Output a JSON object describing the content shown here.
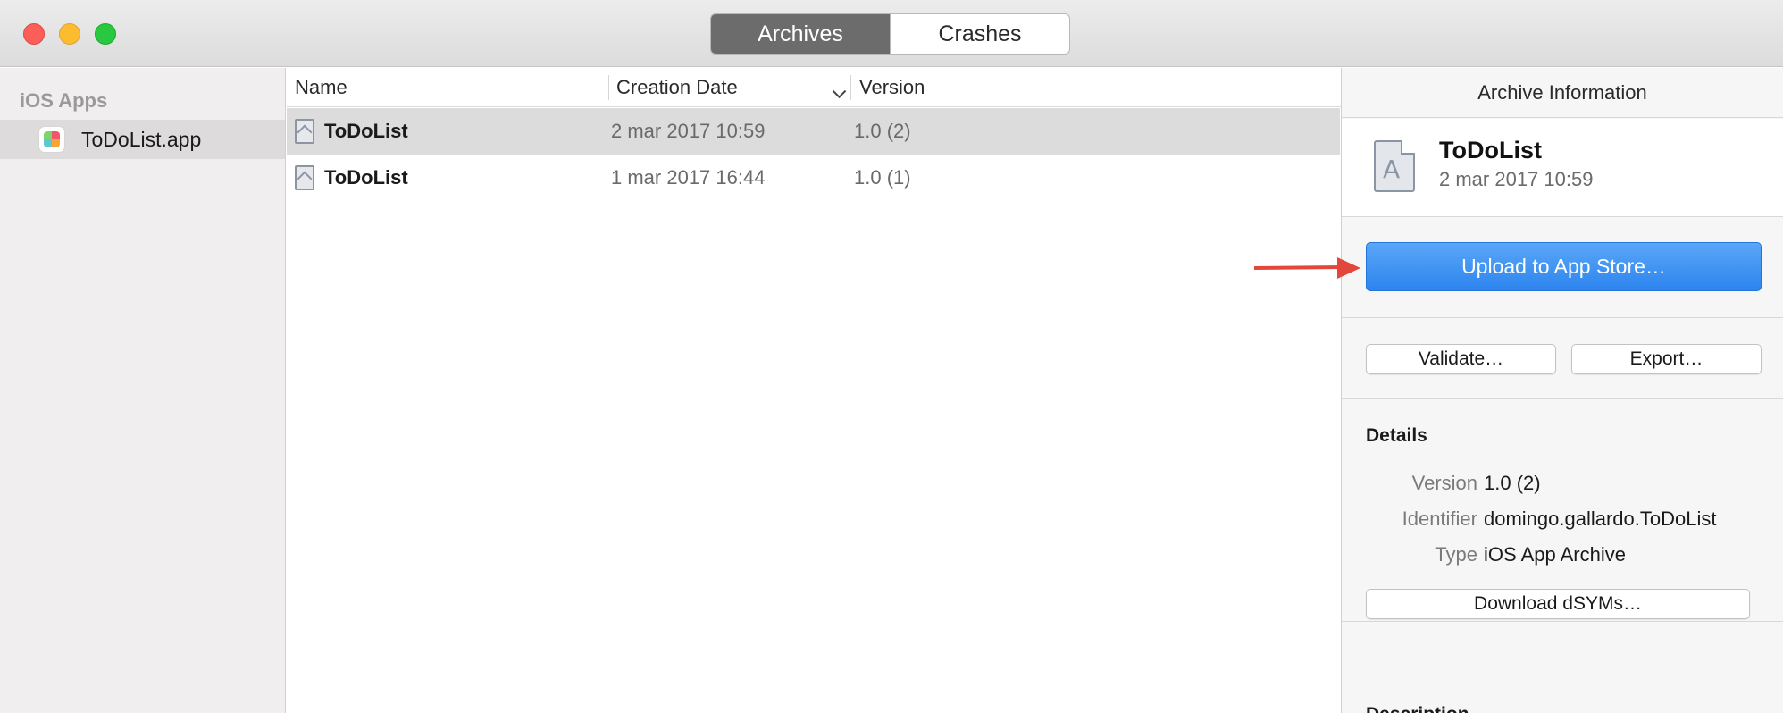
{
  "window": {
    "segments": [
      {
        "label": "Archives",
        "active": true
      },
      {
        "label": "Crashes",
        "active": false
      }
    ]
  },
  "sidebar": {
    "heading": "iOS Apps",
    "items": [
      {
        "label": "ToDoList.app",
        "icon": "app-icon",
        "selected": true
      }
    ]
  },
  "list": {
    "columns": [
      {
        "label": "Name"
      },
      {
        "label": "Creation Date",
        "sorted": "descending"
      },
      {
        "label": "Version"
      }
    ],
    "rows": [
      {
        "name": "ToDoList",
        "date": "2 mar 2017 10:59",
        "version": "1.0 (2)",
        "selected": true
      },
      {
        "name": "ToDoList",
        "date": "1 mar 2017 16:44",
        "version": "1.0 (1)",
        "selected": false
      }
    ]
  },
  "inspector": {
    "title": "Archive Information",
    "archive_name": "ToDoList",
    "archive_date": "2 mar 2017 10:59",
    "upload_label": "Upload to App Store…",
    "validate_label": "Validate…",
    "export_label": "Export…",
    "details_heading": "Details",
    "details": [
      {
        "label": "Version",
        "value": "1.0 (2)"
      },
      {
        "label": "Identifier",
        "value": "domingo.gallardo.ToDoList"
      },
      {
        "label": "Type",
        "value": "iOS App Archive"
      }
    ],
    "download_label": "Download dSYMs…",
    "description_heading": "Description"
  },
  "colors": {
    "accent_blue": "#2c84ee",
    "annotation_arrow": "#e3463b",
    "selected_row": "#dcdcdc"
  }
}
